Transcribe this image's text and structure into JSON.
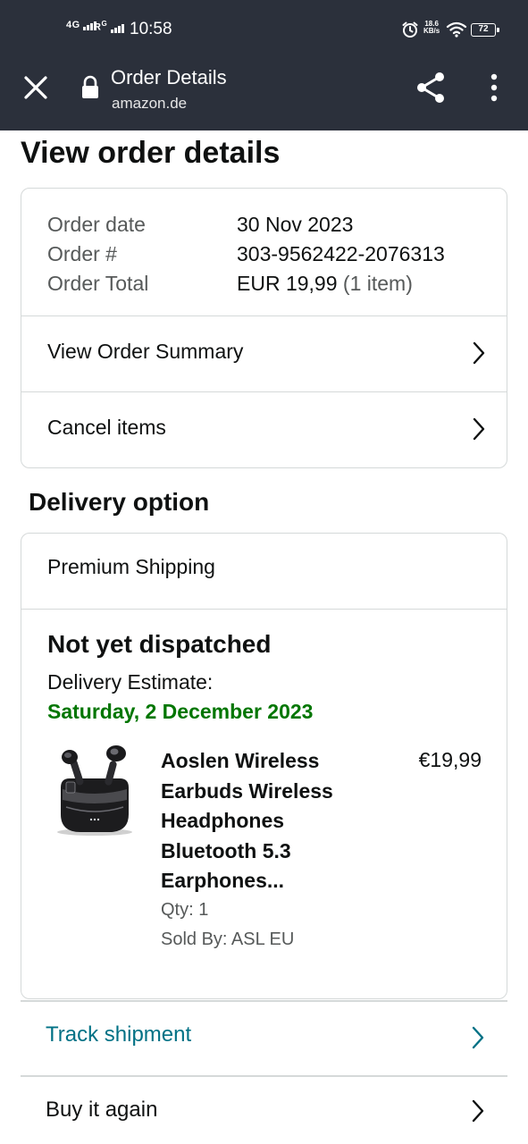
{
  "status_bar": {
    "signal1": "4G",
    "signal2": "R",
    "signal2_sup": "G",
    "time": "10:58",
    "net_speed_value": "18.6",
    "net_speed_unit": "KB/s",
    "battery": "72",
    "icons": [
      "alarm-icon",
      "wifi-icon",
      "battery-icon"
    ]
  },
  "browser_header": {
    "title": "Order Details",
    "domain": "amazon.de",
    "icons": [
      "close-icon",
      "lock-icon",
      "share-icon",
      "more-vert-icon"
    ]
  },
  "page": {
    "title": "View order details"
  },
  "order_summary": {
    "rows": [
      {
        "label": "Order date",
        "value": "30 Nov 2023"
      },
      {
        "label": "Order #",
        "value": "303-9562422-2076313"
      },
      {
        "label": "Order Total",
        "value": "EUR 19,99",
        "extra": "(1 item)"
      }
    ],
    "links": [
      {
        "label": "View Order Summary"
      },
      {
        "label": "Cancel items"
      }
    ]
  },
  "delivery": {
    "section_title": "Delivery option",
    "shipping_method": "Premium Shipping",
    "status": "Not yet dispatched",
    "estimate_label": "Delivery Estimate:",
    "estimate_date": "Saturday, 2 December 2023",
    "item": {
      "name_lines": [
        "Aoslen Wireless",
        "Earbuds Wireless",
        "Headphones",
        "Bluetooth 5.3",
        "Earphones..."
      ],
      "price": "€19,99",
      "qty": "Qty: 1",
      "sold_by": "Sold By: ASL EU"
    }
  },
  "actions": [
    {
      "label": "Track shipment"
    },
    {
      "label": "Buy it again"
    }
  ],
  "colors": {
    "header_bg": "#2b303b",
    "green_estimate": "#007600",
    "teal_link": "#007185",
    "border": "#d5d9d9"
  }
}
